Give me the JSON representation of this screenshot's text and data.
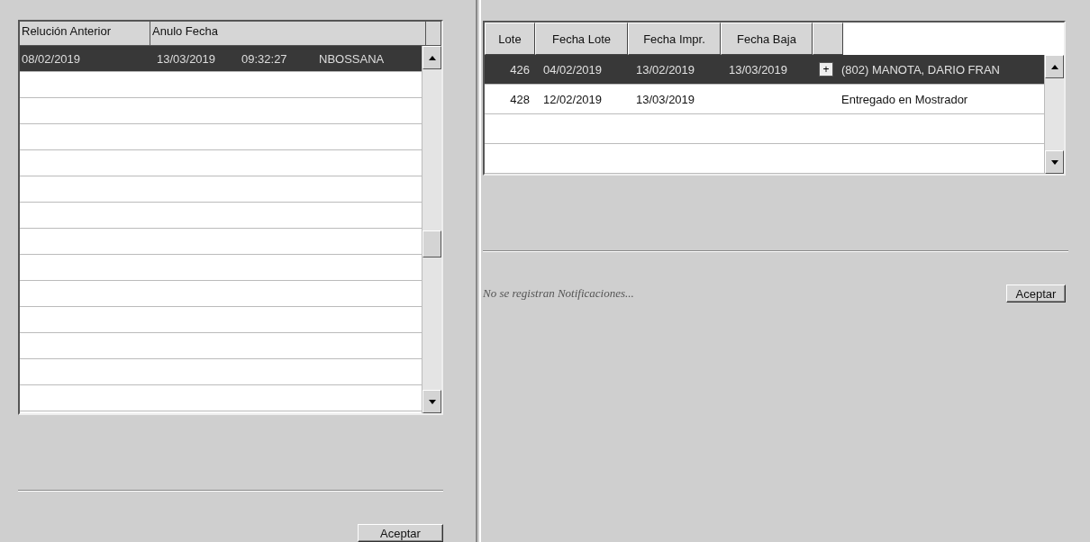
{
  "left_panel": {
    "table": {
      "columns": [
        "Relución Anterior",
        "Anulo Fecha"
      ],
      "rows": [
        {
          "selected": true,
          "cells": [
            "08/02/2019",
            "13/03/2019",
            "09:32:27",
            "NBOSSANA"
          ]
        }
      ]
    },
    "button": "Aceptar"
  },
  "right_panel": {
    "table": {
      "columns": [
        "Lote",
        "Fecha Lote",
        "Fecha Impr.",
        "Fecha Baja"
      ],
      "rows": [
        {
          "selected": true,
          "lote": "426",
          "fecha_lote": "04/02/2019",
          "fecha_impr": "13/02/2019",
          "fecha_baja": "13/03/2019",
          "expand_button": "+",
          "detalle": "(802) MANOTA, DARIO FRAN"
        },
        {
          "selected": false,
          "lote": "428",
          "fecha_lote": "12/02/2019",
          "fecha_impr": "13/03/2019",
          "fecha_baja": "",
          "detalle": "Entregado en Mostrador"
        }
      ]
    },
    "status": "No se registran Notificaciones...",
    "button": "Aceptar"
  }
}
